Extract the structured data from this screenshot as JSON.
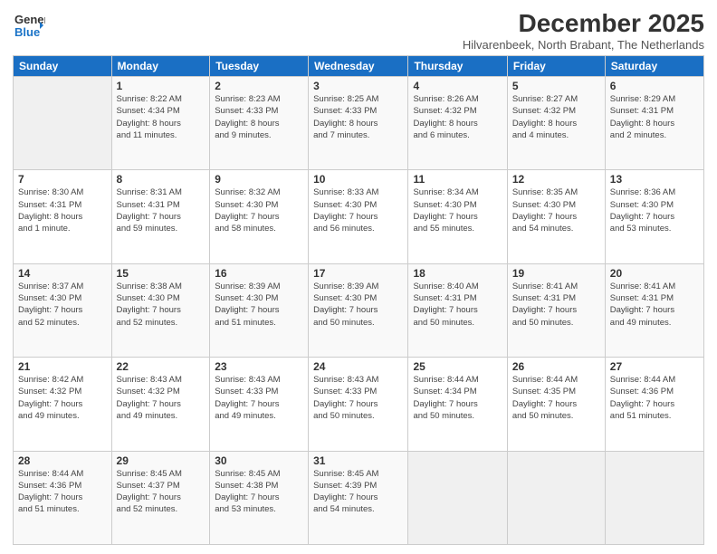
{
  "logo": {
    "line1": "General",
    "line2": "Blue"
  },
  "title": "December 2025",
  "subtitle": "Hilvarenbeek, North Brabant, The Netherlands",
  "days_header": [
    "Sunday",
    "Monday",
    "Tuesday",
    "Wednesday",
    "Thursday",
    "Friday",
    "Saturday"
  ],
  "weeks": [
    [
      {
        "day": "",
        "info": ""
      },
      {
        "day": "1",
        "info": "Sunrise: 8:22 AM\nSunset: 4:34 PM\nDaylight: 8 hours\nand 11 minutes."
      },
      {
        "day": "2",
        "info": "Sunrise: 8:23 AM\nSunset: 4:33 PM\nDaylight: 8 hours\nand 9 minutes."
      },
      {
        "day": "3",
        "info": "Sunrise: 8:25 AM\nSunset: 4:33 PM\nDaylight: 8 hours\nand 7 minutes."
      },
      {
        "day": "4",
        "info": "Sunrise: 8:26 AM\nSunset: 4:32 PM\nDaylight: 8 hours\nand 6 minutes."
      },
      {
        "day": "5",
        "info": "Sunrise: 8:27 AM\nSunset: 4:32 PM\nDaylight: 8 hours\nand 4 minutes."
      },
      {
        "day": "6",
        "info": "Sunrise: 8:29 AM\nSunset: 4:31 PM\nDaylight: 8 hours\nand 2 minutes."
      }
    ],
    [
      {
        "day": "7",
        "info": "Sunrise: 8:30 AM\nSunset: 4:31 PM\nDaylight: 8 hours\nand 1 minute."
      },
      {
        "day": "8",
        "info": "Sunrise: 8:31 AM\nSunset: 4:31 PM\nDaylight: 7 hours\nand 59 minutes."
      },
      {
        "day": "9",
        "info": "Sunrise: 8:32 AM\nSunset: 4:30 PM\nDaylight: 7 hours\nand 58 minutes."
      },
      {
        "day": "10",
        "info": "Sunrise: 8:33 AM\nSunset: 4:30 PM\nDaylight: 7 hours\nand 56 minutes."
      },
      {
        "day": "11",
        "info": "Sunrise: 8:34 AM\nSunset: 4:30 PM\nDaylight: 7 hours\nand 55 minutes."
      },
      {
        "day": "12",
        "info": "Sunrise: 8:35 AM\nSunset: 4:30 PM\nDaylight: 7 hours\nand 54 minutes."
      },
      {
        "day": "13",
        "info": "Sunrise: 8:36 AM\nSunset: 4:30 PM\nDaylight: 7 hours\nand 53 minutes."
      }
    ],
    [
      {
        "day": "14",
        "info": "Sunrise: 8:37 AM\nSunset: 4:30 PM\nDaylight: 7 hours\nand 52 minutes."
      },
      {
        "day": "15",
        "info": "Sunrise: 8:38 AM\nSunset: 4:30 PM\nDaylight: 7 hours\nand 52 minutes."
      },
      {
        "day": "16",
        "info": "Sunrise: 8:39 AM\nSunset: 4:30 PM\nDaylight: 7 hours\nand 51 minutes."
      },
      {
        "day": "17",
        "info": "Sunrise: 8:39 AM\nSunset: 4:30 PM\nDaylight: 7 hours\nand 50 minutes."
      },
      {
        "day": "18",
        "info": "Sunrise: 8:40 AM\nSunset: 4:31 PM\nDaylight: 7 hours\nand 50 minutes."
      },
      {
        "day": "19",
        "info": "Sunrise: 8:41 AM\nSunset: 4:31 PM\nDaylight: 7 hours\nand 50 minutes."
      },
      {
        "day": "20",
        "info": "Sunrise: 8:41 AM\nSunset: 4:31 PM\nDaylight: 7 hours\nand 49 minutes."
      }
    ],
    [
      {
        "day": "21",
        "info": "Sunrise: 8:42 AM\nSunset: 4:32 PM\nDaylight: 7 hours\nand 49 minutes."
      },
      {
        "day": "22",
        "info": "Sunrise: 8:43 AM\nSunset: 4:32 PM\nDaylight: 7 hours\nand 49 minutes."
      },
      {
        "day": "23",
        "info": "Sunrise: 8:43 AM\nSunset: 4:33 PM\nDaylight: 7 hours\nand 49 minutes."
      },
      {
        "day": "24",
        "info": "Sunrise: 8:43 AM\nSunset: 4:33 PM\nDaylight: 7 hours\nand 50 minutes."
      },
      {
        "day": "25",
        "info": "Sunrise: 8:44 AM\nSunset: 4:34 PM\nDaylight: 7 hours\nand 50 minutes."
      },
      {
        "day": "26",
        "info": "Sunrise: 8:44 AM\nSunset: 4:35 PM\nDaylight: 7 hours\nand 50 minutes."
      },
      {
        "day": "27",
        "info": "Sunrise: 8:44 AM\nSunset: 4:36 PM\nDaylight: 7 hours\nand 51 minutes."
      }
    ],
    [
      {
        "day": "28",
        "info": "Sunrise: 8:44 AM\nSunset: 4:36 PM\nDaylight: 7 hours\nand 51 minutes."
      },
      {
        "day": "29",
        "info": "Sunrise: 8:45 AM\nSunset: 4:37 PM\nDaylight: 7 hours\nand 52 minutes."
      },
      {
        "day": "30",
        "info": "Sunrise: 8:45 AM\nSunset: 4:38 PM\nDaylight: 7 hours\nand 53 minutes."
      },
      {
        "day": "31",
        "info": "Sunrise: 8:45 AM\nSunset: 4:39 PM\nDaylight: 7 hours\nand 54 minutes."
      },
      {
        "day": "",
        "info": ""
      },
      {
        "day": "",
        "info": ""
      },
      {
        "day": "",
        "info": ""
      }
    ]
  ]
}
